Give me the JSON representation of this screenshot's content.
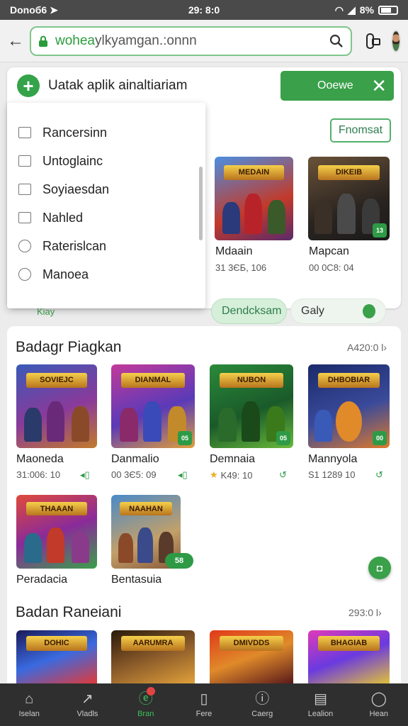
{
  "status_bar": {
    "carrier": "Donoб6",
    "time": "29: 8:0",
    "battery": "8%"
  },
  "browser": {
    "url_main": "wohea",
    "url_rest": "ylkyamgan.:onnn"
  },
  "top_card": {
    "add_label": "Uatak  aplik  ainaltiariam",
    "green_button": "Ooewe",
    "outline_button": "Fnomsat"
  },
  "dropdown": {
    "items": [
      {
        "label": "Rancersinn",
        "icon": "document-icon"
      },
      {
        "label": "Untoglainc",
        "icon": "window-icon"
      },
      {
        "label": "Soyiaesdan",
        "icon": "calendar-icon"
      },
      {
        "label": "Nahled",
        "icon": "square-icon"
      },
      {
        "label": "Raterislcan",
        "icon": "link-icon"
      },
      {
        "label": "Manoea",
        "icon": "chat-icon"
      }
    ]
  },
  "featured": [
    {
      "title": "Mdaain",
      "meta": "31 3ЄБ, 106",
      "banner": "MEDAIN"
    },
    {
      "title": "Mapcan",
      "meta": "00 0С8: 04",
      "banner": "DIKEIB",
      "badge": "13"
    }
  ],
  "chips": {
    "key": "Kiay",
    "green": "Dendcksam",
    "grey": "Galy"
  },
  "section1": {
    "title": "Badagr Piagkan",
    "link": "A420:0 l›",
    "games": [
      {
        "title": "Maoneda",
        "meta": "З1:006: 10",
        "banner": "SOVIEJC"
      },
      {
        "title": "Danmalio",
        "meta": "00 3Є5: 09",
        "banner": "DIANMAL",
        "badge": "05"
      },
      {
        "title": "Demnaia",
        "meta": "K49: 10",
        "banner": "NUBON",
        "badge": "05"
      },
      {
        "title": "Mannyola",
        "meta": "S1 1289 10",
        "banner": "DHBOBIAR",
        "badge": "00"
      },
      {
        "title": "Peradacia",
        "meta": "",
        "banner": "THAAAN"
      },
      {
        "title": "Bentasuia",
        "meta": "",
        "banner": "NAAHAN",
        "badge": "58"
      }
    ]
  },
  "section2": {
    "title": "Badan Raneiani",
    "link": "293:0 l›",
    "games": [
      {
        "banner": "DOHIC"
      },
      {
        "banner": "AARUMRA"
      },
      {
        "banner": "DMIVDDS"
      },
      {
        "banner": "BHAGIAB"
      }
    ]
  },
  "bottom_nav": [
    {
      "label": "Iselan",
      "icon": "home-icon"
    },
    {
      "label": "Vladls",
      "icon": "arrow-icon"
    },
    {
      "label": "Bran",
      "icon": "store-icon"
    },
    {
      "label": "Fere",
      "icon": "file-icon"
    },
    {
      "label": "Caerg",
      "icon": "info-icon"
    },
    {
      "label": "Lealion",
      "icon": "library-icon"
    },
    {
      "label": "Hean",
      "icon": "profile-icon"
    }
  ]
}
